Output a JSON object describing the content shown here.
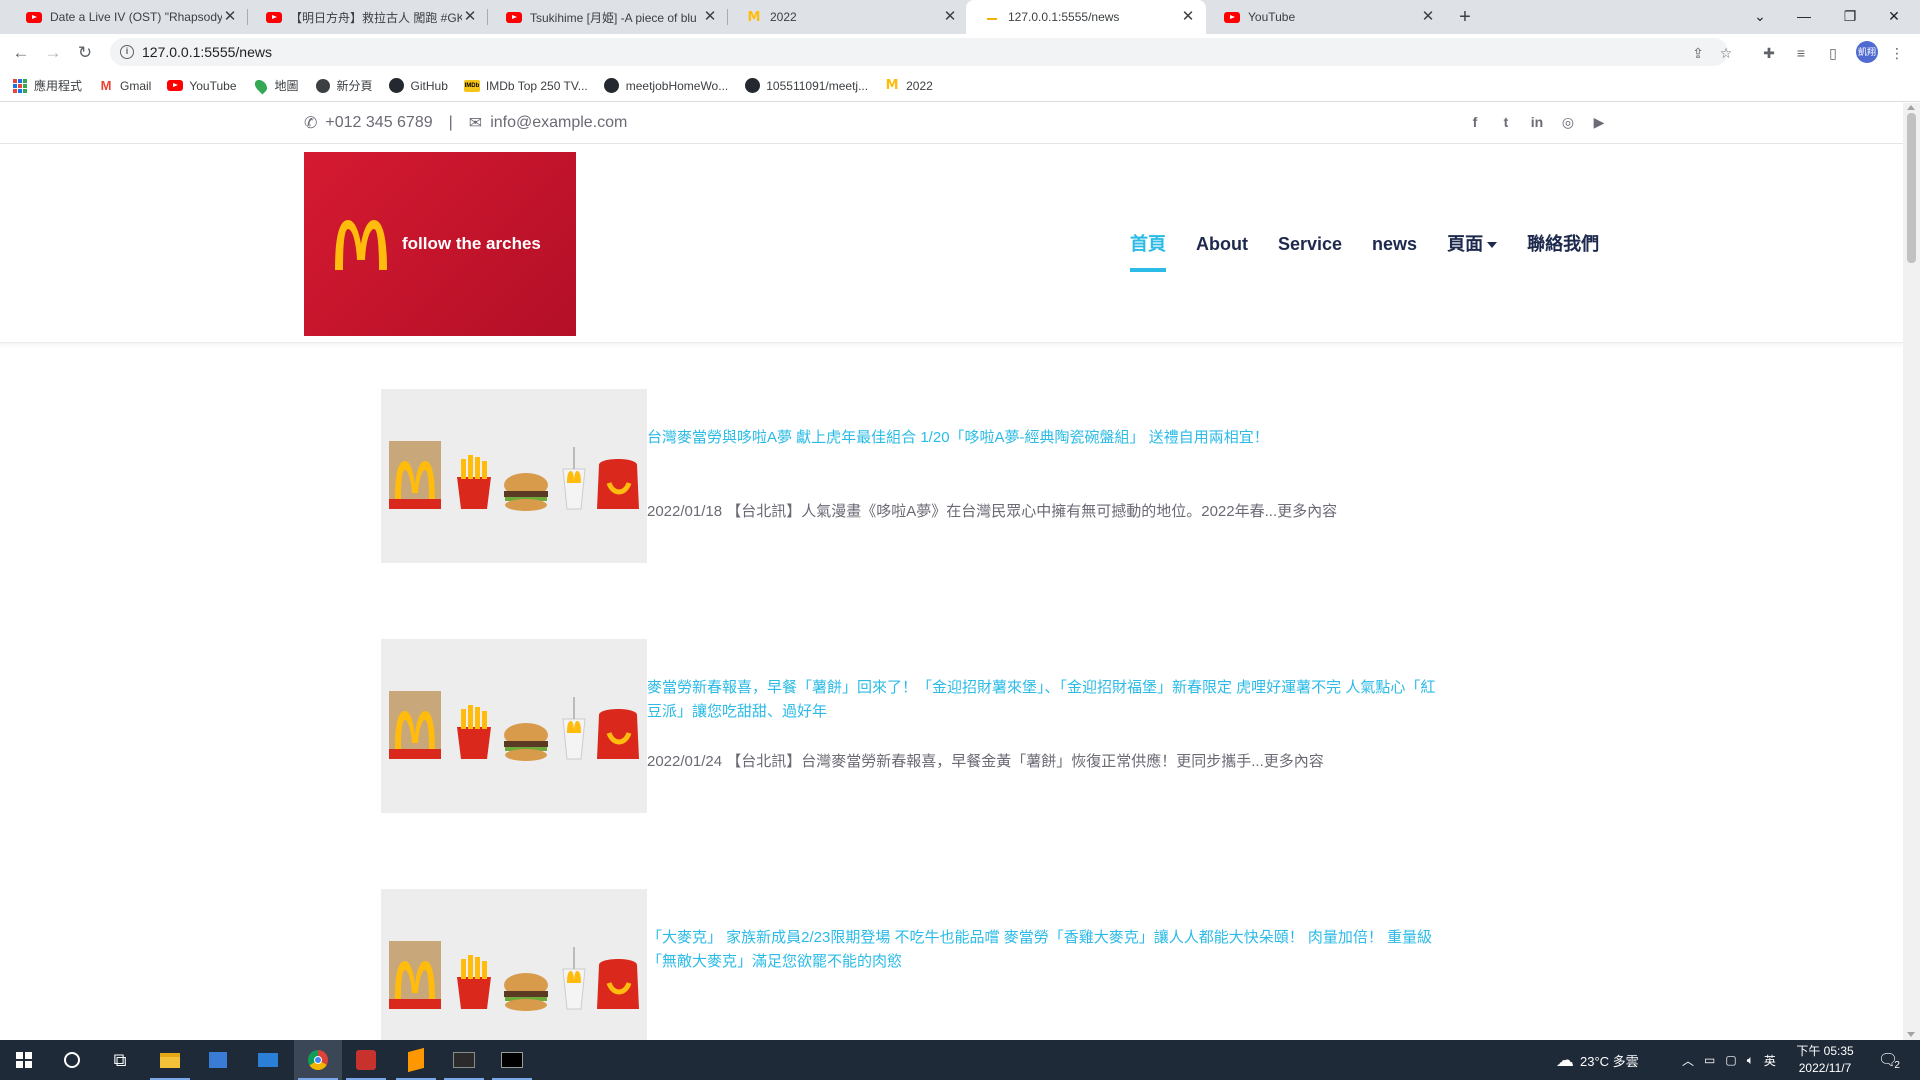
{
  "browser": {
    "tabs": [
      {
        "title": "Date a Live IV (OST) \"Rhapsody",
        "favicon": "youtube-icon",
        "active": false
      },
      {
        "title": "【明日方舟】救拉古人 闖跑 #GK",
        "favicon": "youtube-icon",
        "active": false
      },
      {
        "title": "Tsukihime [月姫] -A piece of blu",
        "favicon": "youtube-icon",
        "active": false
      },
      {
        "title": "2022",
        "favicon": "mcdonalds-icon",
        "active": false
      },
      {
        "title": "127.0.0.1:5555/news",
        "favicon": "loading-icon",
        "active": true
      },
      {
        "title": "YouTube",
        "favicon": "youtube-icon",
        "active": false
      }
    ],
    "new_tab_label": "+",
    "url": "127.0.0.1:5555/news",
    "profile_initials": "凱翔",
    "bookmarks": [
      {
        "label": "應用程式",
        "icon": "apps-icon"
      },
      {
        "label": "Gmail",
        "icon": "gmail-icon"
      },
      {
        "label": "YouTube",
        "icon": "youtube-icon"
      },
      {
        "label": "地圖",
        "icon": "maps-icon"
      },
      {
        "label": "新分頁",
        "icon": "globe-icon"
      },
      {
        "label": "GitHub",
        "icon": "github-icon"
      },
      {
        "label": "IMDb Top 250 TV...",
        "icon": "imdb-icon"
      },
      {
        "label": "meetjobHomeWo...",
        "icon": "github-icon"
      },
      {
        "label": "105511091/meetj...",
        "icon": "github-icon"
      },
      {
        "label": "2022",
        "icon": "mcdonalds-icon"
      }
    ]
  },
  "site": {
    "topbar": {
      "phone": "+012 345 6789",
      "separator": "|",
      "email": "info@example.com",
      "social": [
        "facebook-icon",
        "twitter-icon",
        "linkedin-icon",
        "instagram-icon",
        "youtube-icon"
      ]
    },
    "logo": {
      "tagline": "follow the arches",
      "colors": {
        "background": "#c8102e",
        "arches": "#ffbc0d"
      }
    },
    "nav": [
      {
        "label": "首頁",
        "active": true
      },
      {
        "label": "About",
        "active": false
      },
      {
        "label": "Service",
        "active": false
      },
      {
        "label": "news",
        "active": false
      },
      {
        "label": "頁面",
        "active": false,
        "dropdown": true
      },
      {
        "label": "聯絡我們",
        "active": false
      }
    ],
    "accent_color": "#2bbbe6",
    "news": [
      {
        "title": "台灣麥當勞與哆啦A夢 獻上虎年最佳組合 1/20「哆啦A夢-經典陶瓷碗盤組」 送禮自用兩相宜！",
        "excerpt": "2022/01/18 【台北訊】人氣漫畫《哆啦A夢》在台灣民眾心中擁有無可撼動的地位。2022年春...更多內容"
      },
      {
        "title": "麥當勞新春報喜，早餐「薯餅」回來了！「金迎招財薯來堡」、「金迎招財福堡」新春限定 虎哩好運薯不完 人氣點心「紅豆派」讓您吃甜甜、過好年",
        "excerpt": "2022/01/24 【台北訊】台灣麥當勞新春報喜，早餐金黃「薯餅」恢復正常供應！更同步攜手...更多內容"
      },
      {
        "title": "「大麥克」 家族新成員2/23限期登場 不吃牛也能品嚐 麥當勞「香雞大麥克」讓人人都能大快朵頤！ 肉量加倍！ 重量級「無敵大麥克」滿足您欲罷不能的肉慾",
        "excerpt": ""
      }
    ]
  },
  "taskbar": {
    "apps": [
      "windows-start-icon",
      "search-icon",
      "task-view-icon",
      "file-explorer-icon",
      "store-icon",
      "mail-icon",
      "chrome-icon",
      "game-icon",
      "sublime-icon",
      "terminal-icon",
      "cmd-icon"
    ],
    "weather": "23°C 多雲",
    "ime": "英",
    "time": "下午 05:35",
    "date": "2022/11/7",
    "notifications": "2"
  }
}
